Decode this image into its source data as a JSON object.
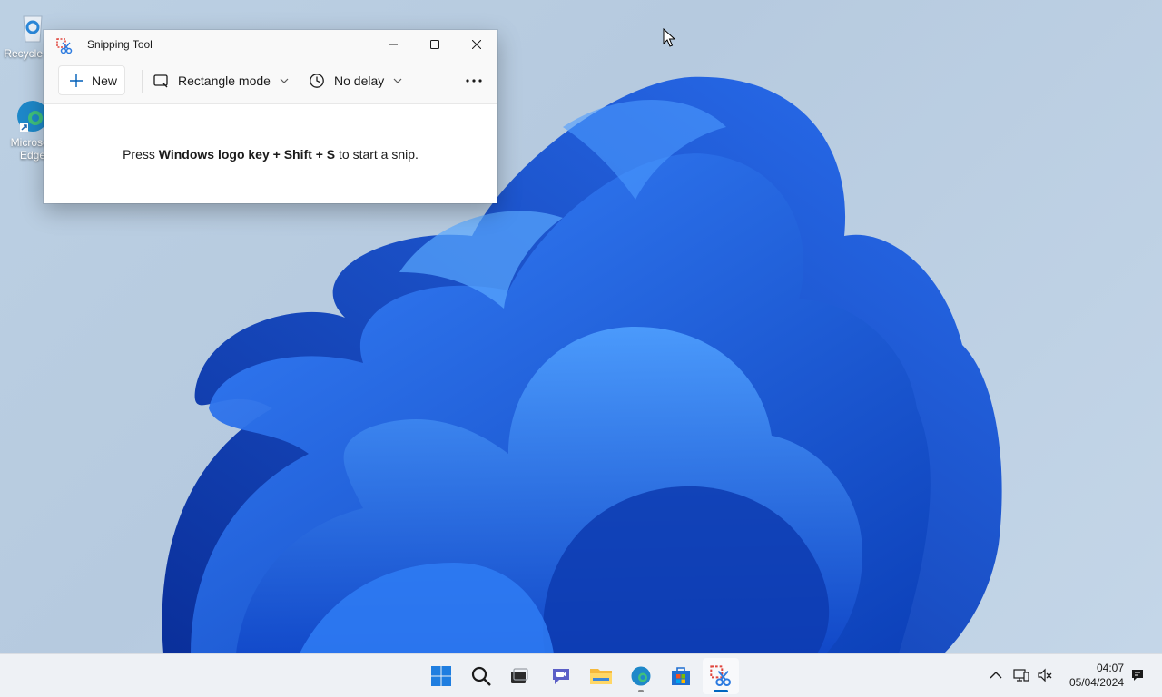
{
  "desktop": {
    "icons": [
      {
        "label": "Recycle Bin",
        "icon": "recycle-bin-icon"
      },
      {
        "label": "Microsoft Edge",
        "icon": "edge-icon"
      }
    ]
  },
  "window": {
    "title": "Snipping Tool",
    "app_icon": "snipping-tool-icon",
    "controls": [
      "minimize-icon",
      "maximize-icon",
      "close-icon"
    ],
    "toolbar": {
      "new_label": "New",
      "mode_label": "Rectangle mode",
      "delay_label": "No delay",
      "more_icon": "more-icon"
    },
    "hint": {
      "pre": "Press ",
      "keys": "Windows logo key + Shift + S",
      "post": " to start a snip."
    }
  },
  "taskbar": {
    "apps": [
      {
        "name": "start",
        "icon": "windows-start-icon",
        "running": false
      },
      {
        "name": "search",
        "icon": "search-icon",
        "running": false
      },
      {
        "name": "task-view",
        "icon": "task-view-icon",
        "running": false
      },
      {
        "name": "chat",
        "icon": "chat-icon",
        "running": false
      },
      {
        "name": "file-explorer",
        "icon": "folder-icon",
        "running": false
      },
      {
        "name": "edge",
        "icon": "edge-icon",
        "running": true
      },
      {
        "name": "store",
        "icon": "store-icon",
        "running": false
      },
      {
        "name": "snipping-tool",
        "icon": "snipping-tool-icon",
        "running": true,
        "active": true
      }
    ],
    "clock": {
      "time": "04:07",
      "date": "05/04/2024"
    }
  },
  "colors": {
    "accent": "#0067c0",
    "wallpaper_blue": "#1a5fe0"
  }
}
